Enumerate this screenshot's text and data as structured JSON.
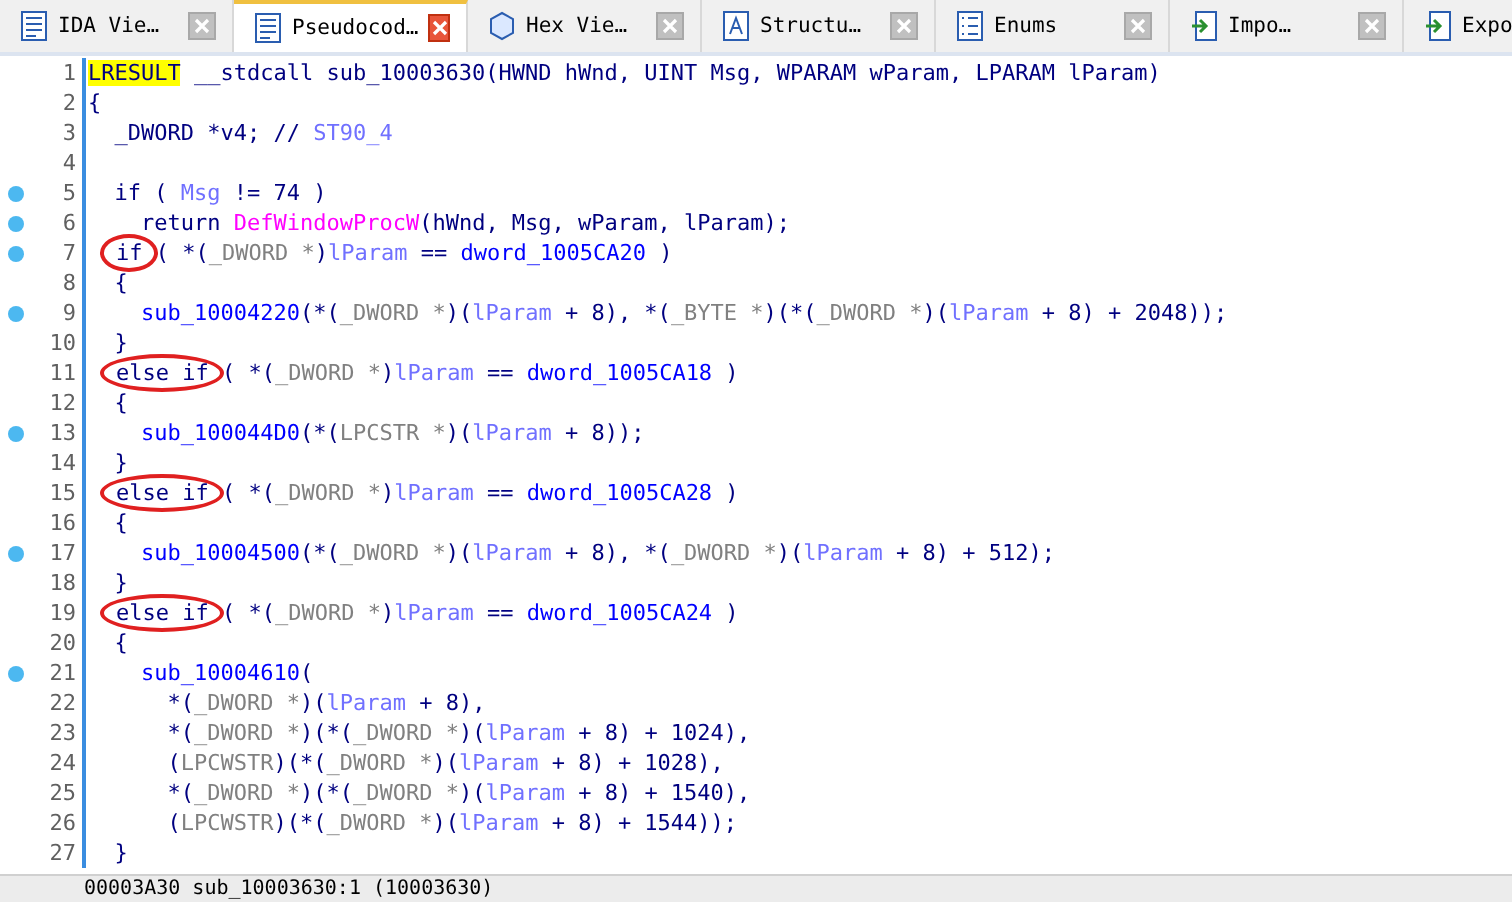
{
  "tabs": [
    {
      "label": "IDA Vie…",
      "kind": "doc",
      "selected": false
    },
    {
      "label": "Pseudocod…",
      "kind": "doc",
      "selected": true
    },
    {
      "label": "Hex Vie…",
      "kind": "hex",
      "selected": false
    },
    {
      "label": "Structu…",
      "kind": "struct",
      "selected": false
    },
    {
      "label": "Enums",
      "kind": "enum",
      "selected": false
    },
    {
      "label": "Impo…",
      "kind": "import",
      "selected": false
    },
    {
      "label": "Expo",
      "kind": "export",
      "selected": false
    }
  ],
  "code": {
    "lines": [
      {
        "number": "1",
        "breakpoint": false,
        "segments": [
          {
            "text": "LRESULT",
            "kind": "hl"
          },
          {
            "text": " __stdcall sub_10003630(HWND hWnd, UINT Msg, WPARAM wParam, LPARAM lParam)",
            "kind": "plain"
          }
        ]
      },
      {
        "number": "2",
        "breakpoint": false,
        "segments": [
          {
            "text": "{",
            "kind": "plain"
          }
        ]
      },
      {
        "number": "3",
        "breakpoint": false,
        "segments": [
          {
            "text": "  _DWORD *v4; // ",
            "kind": "plain"
          },
          {
            "text": "ST90_4",
            "kind": "var"
          }
        ]
      },
      {
        "number": "4",
        "breakpoint": false
      },
      {
        "number": "5",
        "breakpoint": true,
        "segments": [
          {
            "text": "  if ( ",
            "kind": "plain"
          },
          {
            "text": "Msg",
            "kind": "var"
          },
          {
            "text": " != 74 )",
            "kind": "plain"
          }
        ]
      },
      {
        "number": "6",
        "breakpoint": true,
        "segments": [
          {
            "text": "    return ",
            "kind": "plain"
          },
          {
            "text": "DefWindowProcW",
            "kind": "func"
          },
          {
            "text": "(hWnd, Msg, wParam, lParam);",
            "kind": "plain"
          }
        ]
      },
      {
        "number": "7",
        "breakpoint": true,
        "segments": [
          {
            "text": "if",
            "kind": "circled"
          },
          {
            "text": " ( *(",
            "kind": "plain"
          },
          {
            "text": "_DWORD *",
            "kind": "cast"
          },
          {
            "text": ")",
            "kind": "plain"
          },
          {
            "text": "lParam",
            "kind": "var"
          },
          {
            "text": " == ",
            "kind": "plain"
          },
          {
            "text": "dword_1005CA20",
            "kind": "glob"
          },
          {
            "text": " )",
            "kind": "plain"
          }
        ]
      },
      {
        "number": "8",
        "breakpoint": false,
        "segments": [
          {
            "text": "  {",
            "kind": "plain"
          }
        ]
      },
      {
        "number": "9",
        "breakpoint": true,
        "segments": [
          {
            "text": "    sub_10004220",
            "kind": "glob"
          },
          {
            "text": "(*(",
            "kind": "plain"
          },
          {
            "text": "_DWORD *",
            "kind": "cast"
          },
          {
            "text": ")(",
            "kind": "plain"
          },
          {
            "text": "lParam",
            "kind": "var"
          },
          {
            "text": " + 8), *(",
            "kind": "plain"
          },
          {
            "text": "_BYTE *",
            "kind": "cast"
          },
          {
            "text": ")(*(",
            "kind": "plain"
          },
          {
            "text": "_DWORD *",
            "kind": "cast"
          },
          {
            "text": ")(",
            "kind": "plain"
          },
          {
            "text": "lParam",
            "kind": "var"
          },
          {
            "text": " + 8) + 2048));",
            "kind": "plain"
          }
        ]
      },
      {
        "number": "10",
        "breakpoint": false,
        "segments": [
          {
            "text": "  }",
            "kind": "plain"
          }
        ]
      },
      {
        "number": "11",
        "breakpoint": false,
        "segments": [
          {
            "text": "else if",
            "kind": "circled"
          },
          {
            "text": " ( *(",
            "kind": "plain"
          },
          {
            "text": "_DWORD *",
            "kind": "cast"
          },
          {
            "text": ")",
            "kind": "plain"
          },
          {
            "text": "lParam",
            "kind": "var"
          },
          {
            "text": " == ",
            "kind": "plain"
          },
          {
            "text": "dword_1005CA18",
            "kind": "glob"
          },
          {
            "text": " )",
            "kind": "plain"
          }
        ]
      },
      {
        "number": "12",
        "breakpoint": false,
        "segments": [
          {
            "text": "  {",
            "kind": "plain"
          }
        ]
      },
      {
        "number": "13",
        "breakpoint": true,
        "segments": [
          {
            "text": "    sub_100044D0",
            "kind": "glob"
          },
          {
            "text": "(*(",
            "kind": "plain"
          },
          {
            "text": "LPCSTR *",
            "kind": "cast"
          },
          {
            "text": ")(",
            "kind": "plain"
          },
          {
            "text": "lParam",
            "kind": "var"
          },
          {
            "text": " + 8));",
            "kind": "plain"
          }
        ]
      },
      {
        "number": "14",
        "breakpoint": false,
        "segments": [
          {
            "text": "  }",
            "kind": "plain"
          }
        ]
      },
      {
        "number": "15",
        "breakpoint": false,
        "segments": [
          {
            "text": "else if",
            "kind": "circled"
          },
          {
            "text": " ( *(",
            "kind": "plain"
          },
          {
            "text": "_DWORD *",
            "kind": "cast"
          },
          {
            "text": ")",
            "kind": "plain"
          },
          {
            "text": "lParam",
            "kind": "var"
          },
          {
            "text": " == ",
            "kind": "plain"
          },
          {
            "text": "dword_1005CA28",
            "kind": "glob"
          },
          {
            "text": " )",
            "kind": "plain"
          }
        ]
      },
      {
        "number": "16",
        "breakpoint": false,
        "segments": [
          {
            "text": "  {",
            "kind": "plain"
          }
        ]
      },
      {
        "number": "17",
        "breakpoint": true,
        "segments": [
          {
            "text": "    sub_10004500",
            "kind": "glob"
          },
          {
            "text": "(*(",
            "kind": "plain"
          },
          {
            "text": "_DWORD *",
            "kind": "cast"
          },
          {
            "text": ")(",
            "kind": "plain"
          },
          {
            "text": "lParam",
            "kind": "var"
          },
          {
            "text": " + 8), *(",
            "kind": "plain"
          },
          {
            "text": "_DWORD *",
            "kind": "cast"
          },
          {
            "text": ")(",
            "kind": "plain"
          },
          {
            "text": "lParam",
            "kind": "var"
          },
          {
            "text": " + 8) + 512);",
            "kind": "plain"
          }
        ]
      },
      {
        "number": "18",
        "breakpoint": false,
        "segments": [
          {
            "text": "  }",
            "kind": "plain"
          }
        ]
      },
      {
        "number": "19",
        "breakpoint": false,
        "segments": [
          {
            "text": "else if",
            "kind": "circled"
          },
          {
            "text": " ( *(",
            "kind": "plain"
          },
          {
            "text": "_DWORD *",
            "kind": "cast"
          },
          {
            "text": ")",
            "kind": "plain"
          },
          {
            "text": "lParam",
            "kind": "var"
          },
          {
            "text": " == ",
            "kind": "plain"
          },
          {
            "text": "dword_1005CA24",
            "kind": "glob"
          },
          {
            "text": " )",
            "kind": "plain"
          }
        ]
      },
      {
        "number": "20",
        "breakpoint": false,
        "segments": [
          {
            "text": "  {",
            "kind": "plain"
          }
        ]
      },
      {
        "number": "21",
        "breakpoint": true,
        "segments": [
          {
            "text": "    sub_10004610",
            "kind": "glob"
          },
          {
            "text": "(",
            "kind": "plain"
          }
        ]
      },
      {
        "number": "22",
        "breakpoint": false,
        "segments": [
          {
            "text": "      *(",
            "kind": "plain"
          },
          {
            "text": "_DWORD *",
            "kind": "cast"
          },
          {
            "text": ")(",
            "kind": "plain"
          },
          {
            "text": "lParam",
            "kind": "var"
          },
          {
            "text": " + 8),",
            "kind": "plain"
          }
        ]
      },
      {
        "number": "23",
        "breakpoint": false,
        "segments": [
          {
            "text": "      *(",
            "kind": "plain"
          },
          {
            "text": "_DWORD *",
            "kind": "cast"
          },
          {
            "text": ")(*(",
            "kind": "plain"
          },
          {
            "text": "_DWORD *",
            "kind": "cast"
          },
          {
            "text": ")(",
            "kind": "plain"
          },
          {
            "text": "lParam",
            "kind": "var"
          },
          {
            "text": " + 8) + 1024),",
            "kind": "plain"
          }
        ]
      },
      {
        "number": "24",
        "breakpoint": false,
        "segments": [
          {
            "text": "      (",
            "kind": "plain"
          },
          {
            "text": "LPCWSTR",
            "kind": "cast"
          },
          {
            "text": ")(*(",
            "kind": "plain"
          },
          {
            "text": "_DWORD *",
            "kind": "cast"
          },
          {
            "text": ")(",
            "kind": "plain"
          },
          {
            "text": "lParam",
            "kind": "var"
          },
          {
            "text": " + 8) + 1028),",
            "kind": "plain"
          }
        ]
      },
      {
        "number": "25",
        "breakpoint": false,
        "segments": [
          {
            "text": "      *(",
            "kind": "plain"
          },
          {
            "text": "_DWORD *",
            "kind": "cast"
          },
          {
            "text": ")(*(",
            "kind": "plain"
          },
          {
            "text": "_DWORD *",
            "kind": "cast"
          },
          {
            "text": ")(",
            "kind": "plain"
          },
          {
            "text": "lParam",
            "kind": "var"
          },
          {
            "text": " + 8) + 1540),",
            "kind": "plain"
          }
        ]
      },
      {
        "number": "26",
        "breakpoint": false,
        "segments": [
          {
            "text": "      (",
            "kind": "plain"
          },
          {
            "text": "LPCWSTR",
            "kind": "cast"
          },
          {
            "text": ")(*(",
            "kind": "plain"
          },
          {
            "text": "_DWORD *",
            "kind": "cast"
          },
          {
            "text": ")(",
            "kind": "plain"
          },
          {
            "text": "lParam",
            "kind": "var"
          },
          {
            "text": " + 8) + 1544));",
            "kind": "plain"
          }
        ]
      },
      {
        "number": "27",
        "breakpoint": false,
        "segments": [
          {
            "text": "  }",
            "kind": "plain"
          }
        ]
      }
    ]
  },
  "status_bar": {
    "text": "00003A30 sub_10003630:1 (10003630)"
  }
}
